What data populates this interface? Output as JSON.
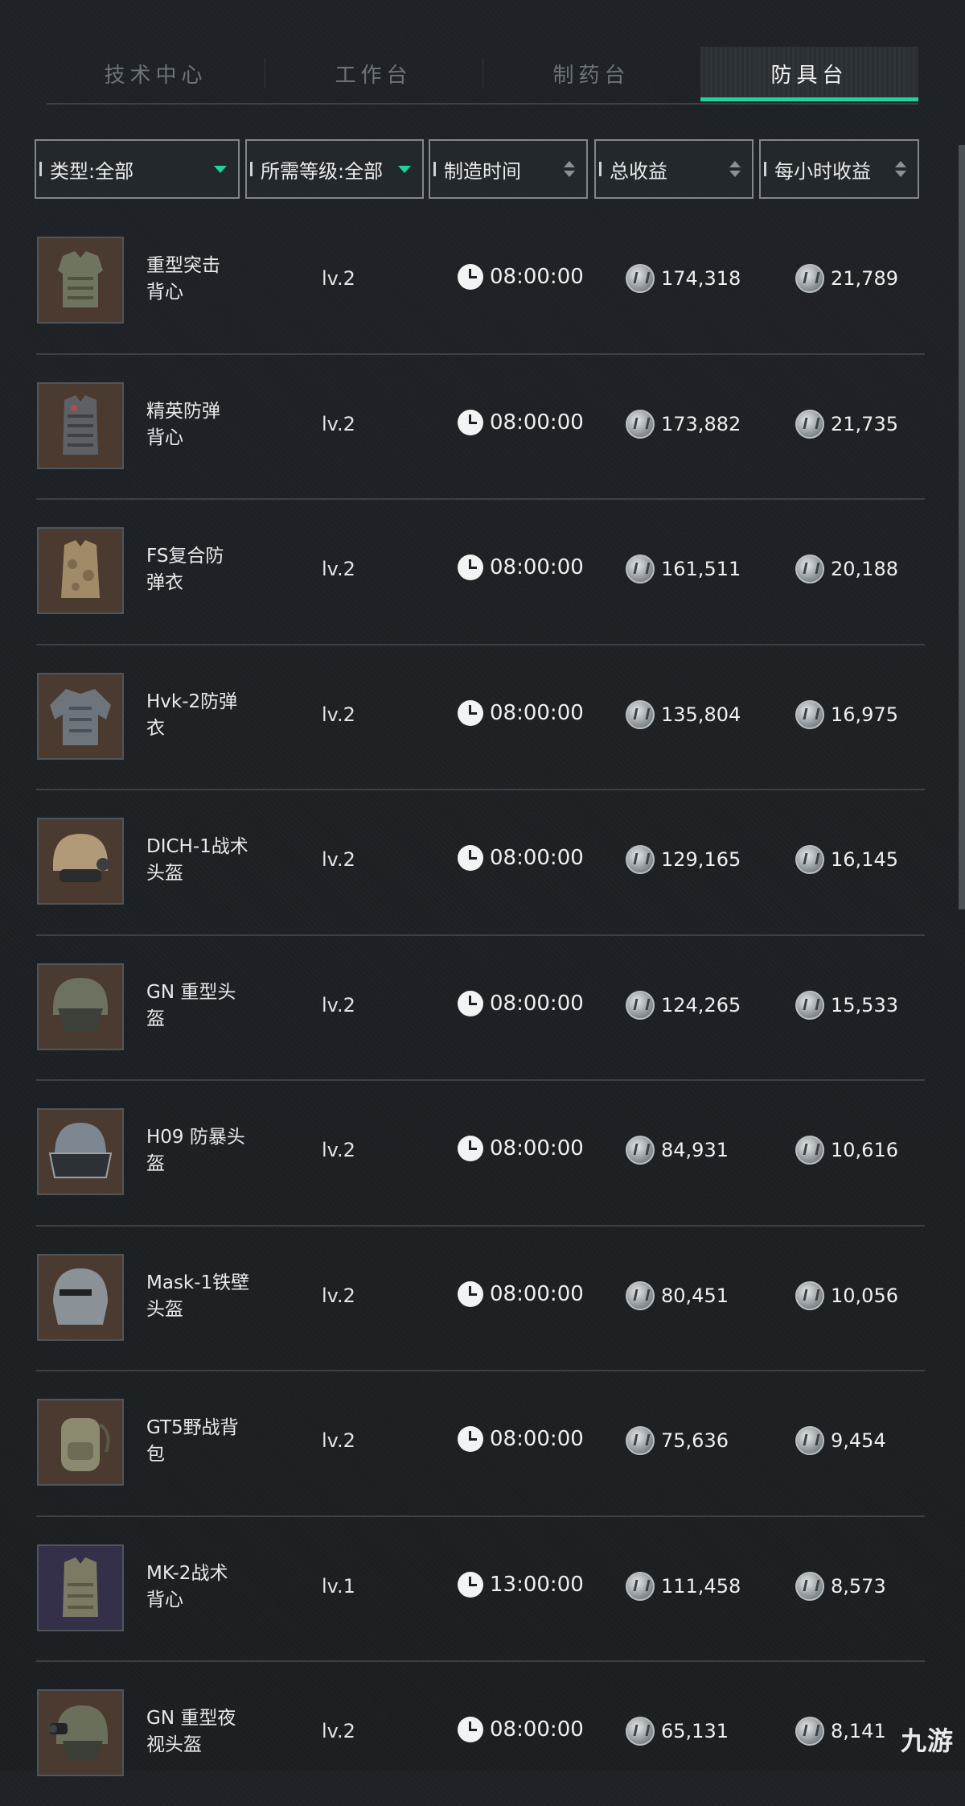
{
  "tabs": [
    {
      "label": "技术中心",
      "active": false
    },
    {
      "label": "工作台",
      "active": false
    },
    {
      "label": "制药台",
      "active": false
    },
    {
      "label": "防具台",
      "active": true
    }
  ],
  "filters": {
    "type": "类型:全部",
    "level": "所需等级:全部",
    "craft_time": "制造时间",
    "total_income": "总收益",
    "hourly_income": "每小时收益"
  },
  "accent_color": "#1fd39a",
  "items": [
    {
      "name_line1": "重型突击",
      "name_line2": "背心",
      "level": "lv.2",
      "time": "08:00:00",
      "total": "174,318",
      "hourly": "21,789",
      "icon": "heavy-vest-icon"
    },
    {
      "name_line1": "精英防弹",
      "name_line2": "背心",
      "level": "lv.2",
      "time": "08:00:00",
      "total": "173,882",
      "hourly": "21,735",
      "icon": "elite-vest-icon"
    },
    {
      "name_line1": "FS复合防",
      "name_line2": "弹衣",
      "level": "lv.2",
      "time": "08:00:00",
      "total": "161,511",
      "hourly": "20,188",
      "icon": "camo-vest-icon"
    },
    {
      "name_line1": "Hvk-2防弹",
      "name_line2": "衣",
      "level": "lv.2",
      "time": "08:00:00",
      "total": "135,804",
      "hourly": "16,975",
      "icon": "armor-suit-icon"
    },
    {
      "name_line1": "DICH-1战术",
      "name_line2": "头盔",
      "level": "lv.2",
      "time": "08:00:00",
      "total": "129,165",
      "hourly": "16,145",
      "icon": "tactical-helmet-icon"
    },
    {
      "name_line1": "GN 重型头",
      "name_line2": "盔",
      "level": "lv.2",
      "time": "08:00:00",
      "total": "124,265",
      "hourly": "15,533",
      "icon": "heavy-helmet-icon"
    },
    {
      "name_line1": "H09 防暴头",
      "name_line2": "盔",
      "level": "lv.2",
      "time": "08:00:00",
      "total": "84,931",
      "hourly": "10,616",
      "icon": "riot-helmet-icon"
    },
    {
      "name_line1": "Mask-1铁壁",
      "name_line2": "头盔",
      "level": "lv.2",
      "time": "08:00:00",
      "total": "80,451",
      "hourly": "10,056",
      "icon": "mask-helmet-icon"
    },
    {
      "name_line1": "GT5野战背",
      "name_line2": "包",
      "level": "lv.2",
      "time": "08:00:00",
      "total": "75,636",
      "hourly": "9,454",
      "icon": "backpack-icon"
    },
    {
      "name_line1": "MK-2战术",
      "name_line2": "背心",
      "level": "lv.1",
      "time": "13:00:00",
      "total": "111,458",
      "hourly": "8,573",
      "icon": "tactical-vest-icon"
    },
    {
      "name_line1": "GN 重型夜",
      "name_line2": "视头盔",
      "level": "lv.2",
      "time": "08:00:00",
      "total": "65,131",
      "hourly": "8,141",
      "icon": "night-vision-helmet-icon"
    }
  ],
  "watermark": "九游"
}
